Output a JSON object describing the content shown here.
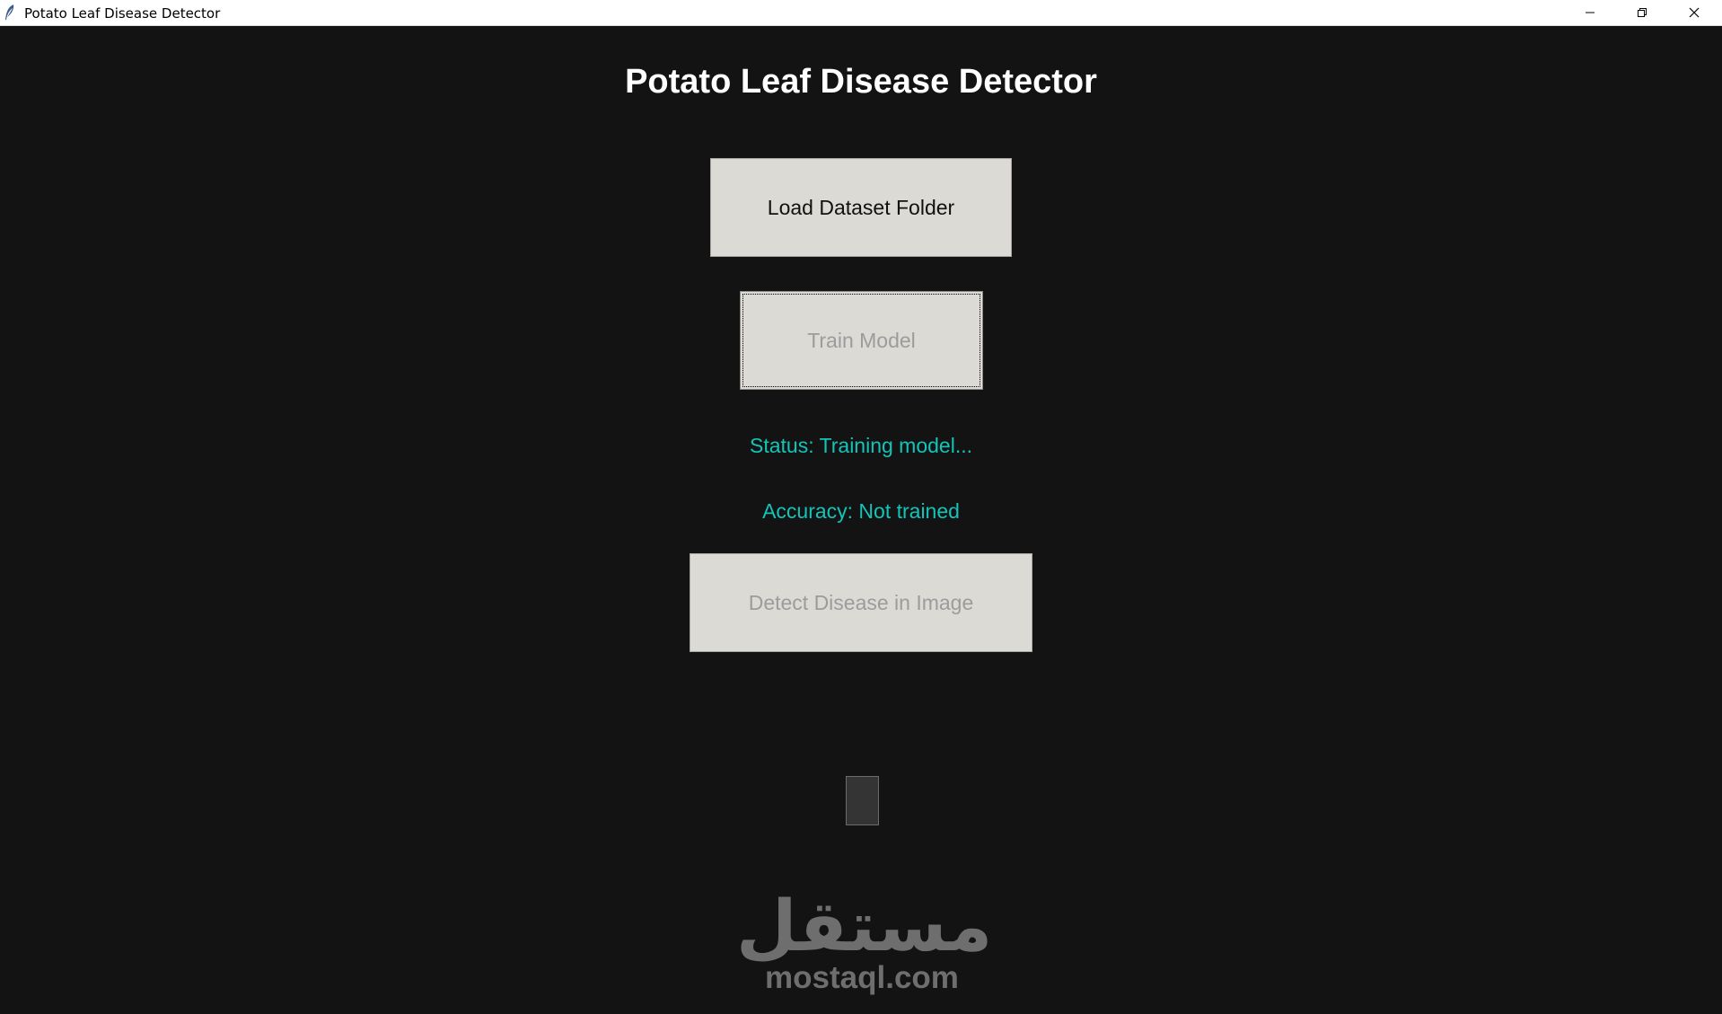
{
  "window": {
    "title": "Potato Leaf Disease Detector",
    "icon": "feather-icon",
    "controls": [
      "minimize-icon",
      "restore-icon",
      "close-icon"
    ]
  },
  "main": {
    "heading": "Potato Leaf Disease Detector",
    "load_button": "Load Dataset Folder",
    "train_button": "Train Model",
    "status": "Status: Training model...",
    "accuracy": "Accuracy: Not trained",
    "detect_button": "Detect Disease in Image"
  },
  "watermark": {
    "arabic": "مستقل",
    "latin": "mostaql.com"
  },
  "colors": {
    "background": "#131313",
    "status_text": "#14c4b8",
    "button_bg": "#dcdad5",
    "disabled_text": "#9c9c9c"
  }
}
